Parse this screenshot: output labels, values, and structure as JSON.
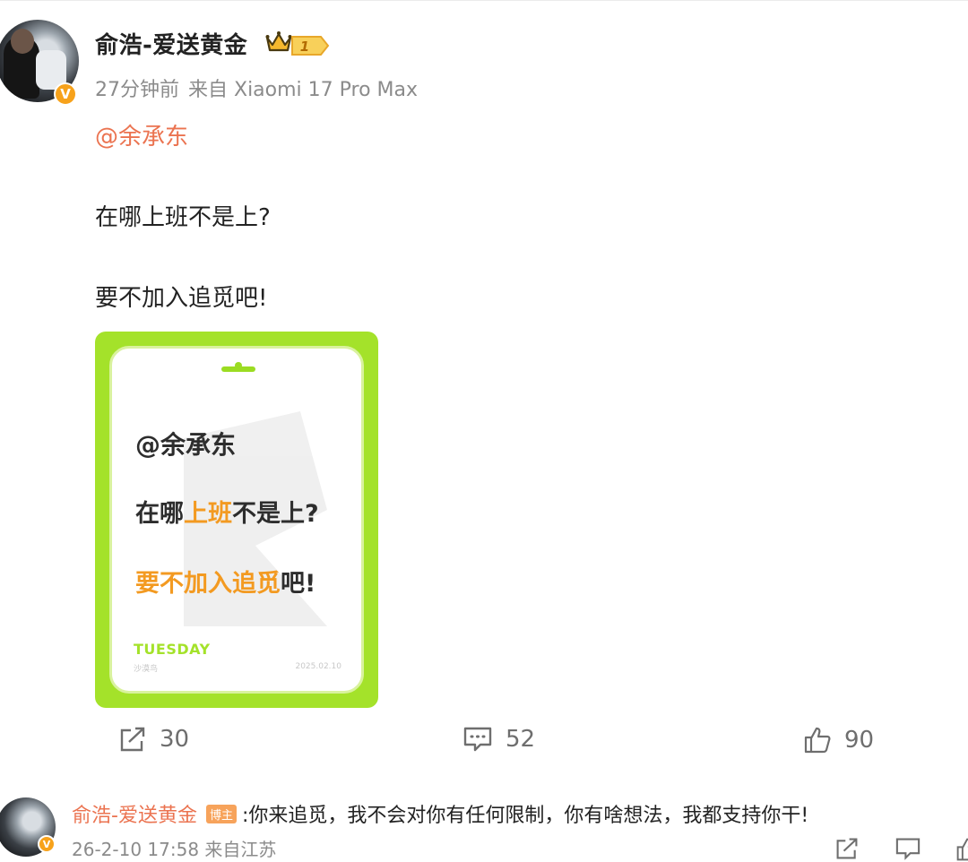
{
  "post": {
    "author": "俞浩-爱送黄金",
    "level": "1",
    "time": "27分钟前",
    "source": "来自 Xiaomi 17 Pro Max",
    "mention": "@余承东",
    "text_line1": "在哪上班不是上?",
    "text_line2": "要不加入追觅吧!"
  },
  "card": {
    "mention": "@余承东",
    "q_pre": "在哪",
    "q_hl": "上班",
    "q_post": "不是上?",
    "a_hl": "要不加入追觅",
    "a_post": "吧!",
    "day": "TUESDAY",
    "foot_left": "沙漠鸟",
    "date": "2025.02.10"
  },
  "actions": {
    "share_count": "30",
    "comment_count": "52",
    "like_count": "90"
  },
  "comment": {
    "author": "俞浩-爱送黄金",
    "badge": "博主",
    "text": ":你来追觅，我不会对你有任何限制，你有啥想法，我都支持你干!",
    "time": "26-2-10 17:58",
    "source": "来自江苏"
  },
  "colors": {
    "accent_orange": "#eb7350",
    "card_green": "#a4e22a",
    "badge_gold": "#f7a21b"
  }
}
